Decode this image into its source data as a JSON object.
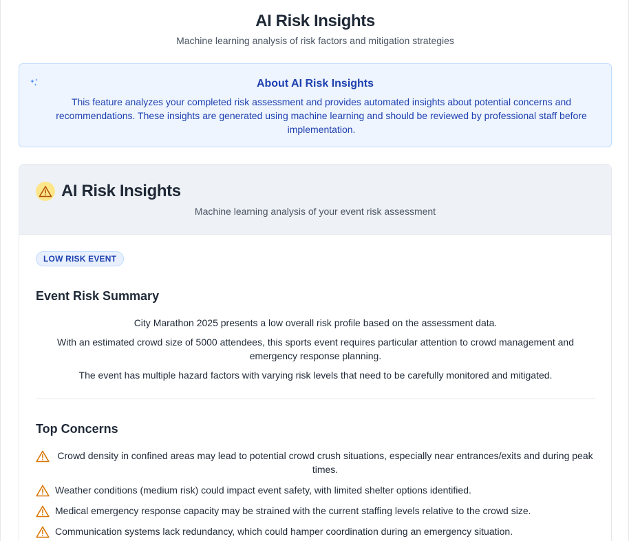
{
  "header": {
    "title": "AI Risk Insights",
    "subtitle": "Machine learning analysis of risk factors and mitigation strategies"
  },
  "about": {
    "icon": "sparkle-icon",
    "title": "About AI Risk Insights",
    "text": "This feature analyzes your completed risk assessment and provides automated insights about potential concerns and recommendations. These insights are generated using machine learning and should be reviewed by professional staff before implementation."
  },
  "card": {
    "icon": "warning-icon",
    "title": "AI Risk Insights",
    "subtitle": "Machine learning analysis of your event risk assessment",
    "badge": "LOW RISK EVENT",
    "summary": {
      "title": "Event Risk Summary",
      "paragraphs": [
        "City Marathon 2025 presents a low overall risk profile based on the assessment data.",
        "With an estimated crowd size of 5000 attendees, this sports event requires particular attention to crowd management and emergency response planning.",
        "The event has multiple hazard factors with varying risk levels that need to be carefully monitored and mitigated."
      ]
    },
    "concerns": {
      "title": "Top Concerns",
      "items": [
        "Crowd density in confined areas may lead to potential crowd crush situations, especially near entrances/exits and during peak times.",
        "Weather conditions (medium risk) could impact event safety, with limited shelter options identified.",
        "Medical emergency response capacity may be strained with the current staffing levels relative to the crowd size.",
        "Communication systems lack redundancy, which could hamper coordination during an emergency situation."
      ]
    }
  },
  "colors": {
    "accent_blue": "#1e40af",
    "warning_amber": "#d97706",
    "warning_bg": "#fde68a",
    "about_bg": "#eef5ff"
  }
}
